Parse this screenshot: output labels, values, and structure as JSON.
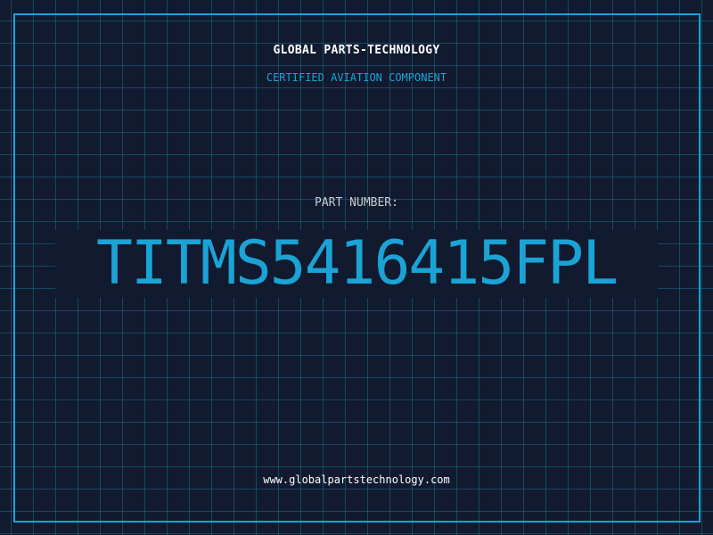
{
  "header": {
    "brand": "GLOBAL PARTS-TECHNOLOGY",
    "subtitle": "CERTIFIED AVIATION COMPONENT"
  },
  "part": {
    "label": "PART NUMBER:",
    "number": "TITMS5416415FPL"
  },
  "footer": {
    "url": "www.globalpartstechnology.com"
  },
  "colors": {
    "background": "#111a2e",
    "accent": "#1ba3d6",
    "grid": "#1a6e8c"
  }
}
